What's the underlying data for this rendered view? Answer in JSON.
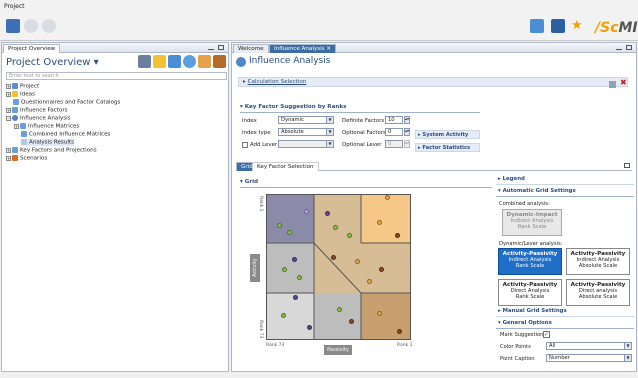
{
  "menu": {
    "title": "Project"
  },
  "brand": {
    "logo_prefix": "/Sc",
    "logo_suffix": "MI"
  },
  "left_panel": {
    "tab_label": "Project Overview",
    "title": "Project Overview ▾",
    "filter_placeholder": "Enter text to search",
    "tree": [
      {
        "label": "Project",
        "expander": "+",
        "icon_color": "#5b8fd1"
      },
      {
        "label": "Ideas",
        "expander": "+",
        "icon_color": "#f2c231"
      },
      {
        "label": "Questionnaires and Factor Catalogs",
        "expander": "",
        "icon_color": "#6a9fd8"
      },
      {
        "label": "Influence Factors",
        "expander": "+",
        "icon_color": "#6a9fd8"
      },
      {
        "label": "Influence Analysis",
        "expander": "−",
        "icon_color": "#4f86c6"
      },
      {
        "label": "Influence Matrices",
        "expander": "+",
        "icon_color": "#6a9fd8"
      },
      {
        "label": "Combined Influence Matrices",
        "expander": "",
        "icon_color": "#6a9fd8"
      },
      {
        "label": "Analysis Results",
        "expander": "",
        "icon_color": "#b6c7de"
      },
      {
        "label": "Key Factors and Projections",
        "expander": "+",
        "icon_color": "#6a9fd8"
      },
      {
        "label": "Scenarios",
        "expander": "+",
        "icon_color": "#d66f2a"
      }
    ]
  },
  "right_panel": {
    "tab_welcome": "Welcome",
    "tab_influence": "Influence Analysis",
    "title": "Influence Analysis",
    "calc_selection": "Calculation Selection",
    "key_factor_title": "Key Factor Suggestion by Ranks",
    "index_label": "Index",
    "index_value": "Dynamic",
    "index_type_label": "Index type",
    "index_type_value": "Absolute",
    "add_lever_label": "Add Lever",
    "definite_label": "Definite Factors",
    "definite_value": "10",
    "optional_label": "Optional Factors",
    "optional_value": "0",
    "optional_lever_label": "Optional Lever",
    "optional_lever_value": "0",
    "system_activity": "System Activity",
    "factor_statistics": "Factor Statistics",
    "subtab_grid": "Grid",
    "subtab_keyfactor": "Key Factor Selection",
    "grid_section": "Grid",
    "axis_activity": "Activity",
    "axis_passivity": "Passivity",
    "rank_top": "Rank 1",
    "rank_bottom_left": "Rank 73",
    "rank_bottom_right": "Rank 1",
    "rank_left_bottom": "Rank 73",
    "legend": "Legend",
    "auto_grid": "Automatic Grid Settings",
    "combined_analysis": "Combined analysis:",
    "dyn_impact_title": "Dynamic-Impact",
    "dyn_impact_sub1": "Indirect Analysis",
    "dyn_impact_sub2": "Rank Scale",
    "dyn_lever": "Dynamic/Lever analysis:",
    "ap1_title": "Activity-Passivity",
    "ap1_sub1": "Indirect Analysis",
    "ap1_sub2": "Rank Scale",
    "ap2_title": "Activity-Passivity",
    "ap2_sub1": "Indirect Analysis",
    "ap2_sub2": "Absolute Scale",
    "ap3_title": "Activity-Passivity",
    "ap3_sub1": "Direct Analysis",
    "ap3_sub2": "Rank Scale",
    "ap4_title": "Activity-Passivity",
    "ap4_sub1": "Direct analysis",
    "ap4_sub2": "Absolute Scale",
    "manual_grid": "Manual Grid Settings",
    "general_options": "General Options",
    "mark_suggestions": "Mark Suggestions",
    "color_points_label": "Color Points",
    "color_points_value": "All",
    "point_caption_label": "Point Caption",
    "point_caption_value": "Number"
  },
  "colors": {
    "accent": "#2a4d80",
    "selected_box": "#1f6fc9",
    "zone_purple": "#8b8aa8",
    "zone_tan": "#d7bd96",
    "zone_orange": "#f5c888",
    "zone_grey": "#bdbdbd",
    "zone_brown": "#c8a070"
  }
}
